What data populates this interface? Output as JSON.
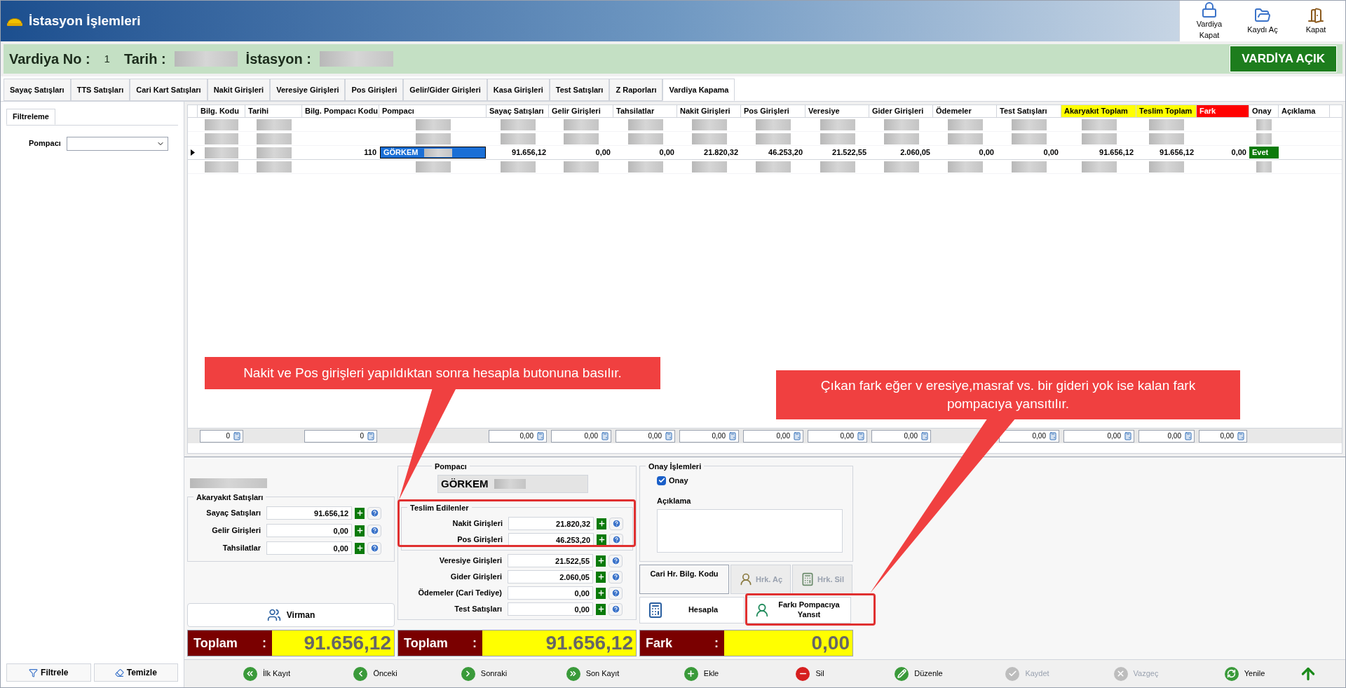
{
  "window": {
    "title": "İstasyon İşlemleri"
  },
  "toolbar": [
    {
      "label": "Vardiya Kapat",
      "kind": "close-shift"
    },
    {
      "label": "Kaydı Aç",
      "kind": "open-record"
    },
    {
      "label": "Kapat",
      "kind": "exit"
    }
  ],
  "shift_bar": {
    "shift_label": "Vardiya No :",
    "shift_no": "1",
    "date_label": "Tarih :",
    "station_label": "İstasyon :",
    "status": "VARDİYA AÇIK"
  },
  "tabs": [
    {
      "label": "Sayaç Satışları",
      "selected": false
    },
    {
      "label": "TTS Satışları",
      "selected": false
    },
    {
      "label": "Cari Kart Satışları",
      "selected": false
    },
    {
      "label": "Nakit Girişleri",
      "selected": false
    },
    {
      "label": "Veresiye Girişleri",
      "selected": false
    },
    {
      "label": "Pos Girişleri",
      "selected": false
    },
    {
      "label": "Gelir/Gider Girişleri",
      "selected": false
    },
    {
      "label": "Kasa Girişleri",
      "selected": false
    },
    {
      "label": "Test Satışları",
      "selected": false
    },
    {
      "label": "Z Raporları",
      "selected": false
    },
    {
      "label": "Vardiya Kapama",
      "selected": true
    }
  ],
  "filter": {
    "title": "Filtreleme",
    "field_label": "Pompacı",
    "buttons": [
      {
        "label": "Filtrele",
        "kind": "filter"
      },
      {
        "label": "Temizle",
        "kind": "clear"
      }
    ]
  },
  "grid": {
    "columns": [
      {
        "label": "Bilg. Kodu"
      },
      {
        "label": "Tarihi"
      },
      {
        "label": "Bilg. Pompacı Kodu"
      },
      {
        "label": "Pompacı"
      },
      {
        "label": "Sayaç Satışları"
      },
      {
        "label": "Gelir Girişleri"
      },
      {
        "label": "Tahsilatlar"
      },
      {
        "label": "Nakit Girişleri"
      },
      {
        "label": "Pos Girişleri"
      },
      {
        "label": "Veresiye"
      },
      {
        "label": "Gider Girişleri"
      },
      {
        "label": "Ödemeler"
      },
      {
        "label": "Test Satışları"
      },
      {
        "label": "Akaryakıt Toplam",
        "color": "#ffff00"
      },
      {
        "label": "Teslim Toplam",
        "color": "#ffff00"
      },
      {
        "label": "Fark",
        "color": "#ff0000"
      },
      {
        "label": "Onay"
      },
      {
        "label": "Açıklama"
      }
    ],
    "rows": [
      {
        "kind": "blurred",
        "selected": false
      },
      {
        "kind": "blurred",
        "selected": false
      },
      {
        "kind": "data",
        "selected": true,
        "cells": [
          {
            "kind": "blurred"
          },
          {
            "kind": "blurred"
          },
          {
            "kind": "text",
            "text": "110"
          },
          {
            "kind": "name",
            "text": "GÖRKEM"
          },
          {
            "kind": "text",
            "text": "91.656,12"
          },
          {
            "kind": "text",
            "text": "0,00"
          },
          {
            "kind": "text",
            "text": "0,00"
          },
          {
            "kind": "text",
            "text": "21.820,32"
          },
          {
            "kind": "text",
            "text": "46.253,20"
          },
          {
            "kind": "text",
            "text": "21.522,55"
          },
          {
            "kind": "text",
            "text": "2.060,05"
          },
          {
            "kind": "text",
            "text": "0,00"
          },
          {
            "kind": "text",
            "text": "0,00"
          },
          {
            "kind": "text",
            "text": "91.656,12"
          },
          {
            "kind": "text",
            "text": "91.656,12"
          },
          {
            "kind": "text",
            "text": "0,00"
          },
          {
            "kind": "approval",
            "text": "Evet"
          },
          {
            "kind": "blank"
          }
        ]
      },
      {
        "kind": "blurred",
        "selected": false
      }
    ],
    "totals": [
      {
        "kind": "total",
        "text": "0"
      },
      {
        "kind": "blank"
      },
      {
        "kind": "total",
        "text": "0"
      },
      {
        "kind": "blank"
      },
      {
        "kind": "total",
        "text": "0,00"
      },
      {
        "kind": "total",
        "text": "0,00"
      },
      {
        "kind": "total",
        "text": "0,00"
      },
      {
        "kind": "total",
        "text": "0,00"
      },
      {
        "kind": "total",
        "text": "0,00"
      },
      {
        "kind": "total",
        "text": "0,00"
      },
      {
        "kind": "total",
        "text": "0,00"
      },
      {
        "kind": "blank"
      },
      {
        "kind": "total",
        "text": "0,00"
      },
      {
        "kind": "total",
        "text": "0,00"
      },
      {
        "kind": "total",
        "text": "0,00"
      },
      {
        "kind": "total",
        "text": "0,00"
      },
      {
        "kind": "blank"
      },
      {
        "kind": "blank"
      }
    ]
  },
  "fuel_sales": {
    "title": "Akaryakıt Satışları",
    "fields": [
      {
        "label": "Sayaç Satışları",
        "value": "91.656,12"
      },
      {
        "label": "Gelir Girişleri",
        "value": "0,00"
      },
      {
        "label": "Tahsilatlar",
        "value": "0,00"
      }
    ],
    "transfer_button": "Virman",
    "total": {
      "label": "Toplam",
      "separator": ":",
      "value": "91.656,12"
    }
  },
  "attendant": {
    "title": "Pompacı",
    "name": "GÖRKEM",
    "delivered": {
      "title": "Teslim Edilenler",
      "fields": [
        {
          "label": "Nakit Girişleri",
          "value": "21.820,32"
        },
        {
          "label": "Pos Girişleri",
          "value": "46.253,20"
        }
      ]
    },
    "fields": [
      {
        "label": "Veresiye Girişleri",
        "value": "21.522,55"
      },
      {
        "label": "Gider Girişleri",
        "value": "2.060,05"
      },
      {
        "label": "Ödemeler (Cari Tediye)",
        "value": "0,00"
      },
      {
        "label": "Test Satışları",
        "value": "0,00"
      }
    ],
    "total": {
      "label": "Toplam",
      "separator": ":",
      "value": "91.656,12"
    }
  },
  "approval": {
    "title": "Onay İşlemleri",
    "checkbox": {
      "label": "Onay",
      "checked": true
    },
    "note_label": "Açıklama",
    "account_label": "Cari Hr. Bilg. Kodu",
    "buttons": [
      {
        "label": "Hrk. Aç",
        "kind": "open-movement",
        "disabled": true
      },
      {
        "label": "Hrk. Sil",
        "kind": "delete-movement",
        "disabled": true
      },
      {
        "label": "Hesapla",
        "kind": "calculate",
        "disabled": false
      },
      {
        "label": "Farkı Pompacıya Yansıt",
        "kind": "reflect",
        "disabled": false
      }
    ],
    "difference": {
      "label": "Fark",
      "separator": ":",
      "value": "0,00"
    }
  },
  "navigation": [
    {
      "label": "İlk Kayıt",
      "kind": "first",
      "disabled": false
    },
    {
      "label": "Önceki",
      "kind": "prev",
      "disabled": false
    },
    {
      "label": "Sonraki",
      "kind": "next",
      "disabled": false
    },
    {
      "label": "Son Kayıt",
      "kind": "last",
      "disabled": false
    },
    {
      "label": "Ekle",
      "kind": "add",
      "disabled": false
    },
    {
      "label": "Sil",
      "kind": "delete",
      "disabled": false
    },
    {
      "label": "Düzenle",
      "kind": "edit",
      "disabled": false
    },
    {
      "label": "Kaydet",
      "kind": "save",
      "disabled": true
    },
    {
      "label": "Vazgeç",
      "kind": "cancel",
      "disabled": true
    },
    {
      "label": "Yenile",
      "kind": "refresh",
      "disabled": false
    }
  ],
  "callouts": [
    {
      "text": "Nakit ve Pos girişleri yapıldıktan sonra hesapla butonuna basılır."
    },
    {
      "text": "Çıkan fark eğer v eresiye,masraf vs. bir gideri yok ise kalan fark pompacıya yansıtılır."
    }
  ]
}
